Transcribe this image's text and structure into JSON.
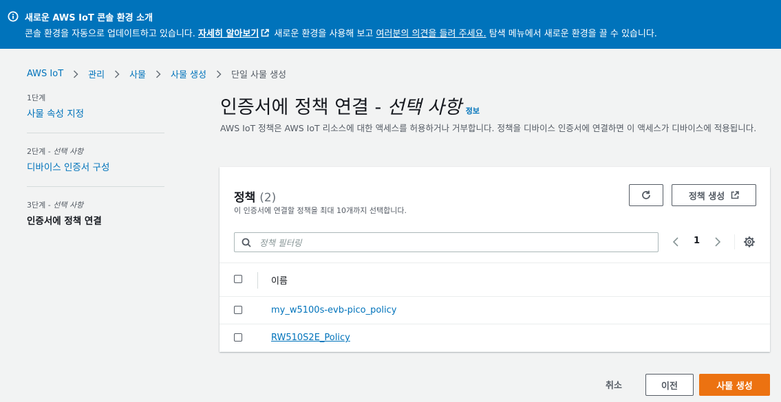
{
  "banner": {
    "icon": "info-icon",
    "title": "새로운 AWS IoT 콘솔 환경 소개",
    "text_before": "콘솔 환경을 자동으로 업데이트하고 있습니다. ",
    "learn_more_link": "자세히 알아보기",
    "text_middle": " 새로운 환경을 사용해 보고 ",
    "feedback_link": "여러분의 의견을 들려 주세요.",
    "text_after": " 탐색 메뉴에서 새로운 환경을 끌 수 있습니다.",
    "background": "#0073bb"
  },
  "breadcrumb": {
    "items": [
      "AWS IoT",
      "관리",
      "사물",
      "사물 생성"
    ],
    "current": "단일 사물 생성"
  },
  "steps": [
    {
      "sub": "1단계",
      "sub_opt": "",
      "label": "사물 속성 지정"
    },
    {
      "sub": "2단계 - ",
      "sub_opt": "선택 사항",
      "label": "디바이스 인증서 구성"
    },
    {
      "sub": "3단계 - ",
      "sub_opt": "선택 사항",
      "label": "인증서에 정책 연결"
    }
  ],
  "page": {
    "title": "인증서에 정책 연결 - ",
    "title_optional": "선택 사항",
    "info": "정보",
    "description": "AWS IoT 정책은 AWS IoT 리소스에 대한 액세스를 허용하거나 거부합니다. 정책을 디바이스 인증서에 연결하면 이 액세스가 디바이스에 적용됩니다."
  },
  "policies_panel": {
    "title": "정책",
    "count": "(2)",
    "description": "이 인증서에 연결할 정책을 최대 10개까지 선택합니다.",
    "refresh_icon": "refresh-icon",
    "create_policy_label": "정책 생성",
    "search_placeholder": "정책 필터링",
    "search_value": "",
    "page_number": "1",
    "column_name": "이름",
    "rows": [
      {
        "name": "my_w5100s-evb-pico_policy"
      },
      {
        "name": "RW510S2E_Policy"
      }
    ]
  },
  "footer": {
    "cancel": "취소",
    "previous": "이전",
    "create_thing": "사물 생성",
    "primary_color": "#ec7211"
  },
  "colors": {
    "link": "#0073bb",
    "background": "#f2f3f3"
  }
}
